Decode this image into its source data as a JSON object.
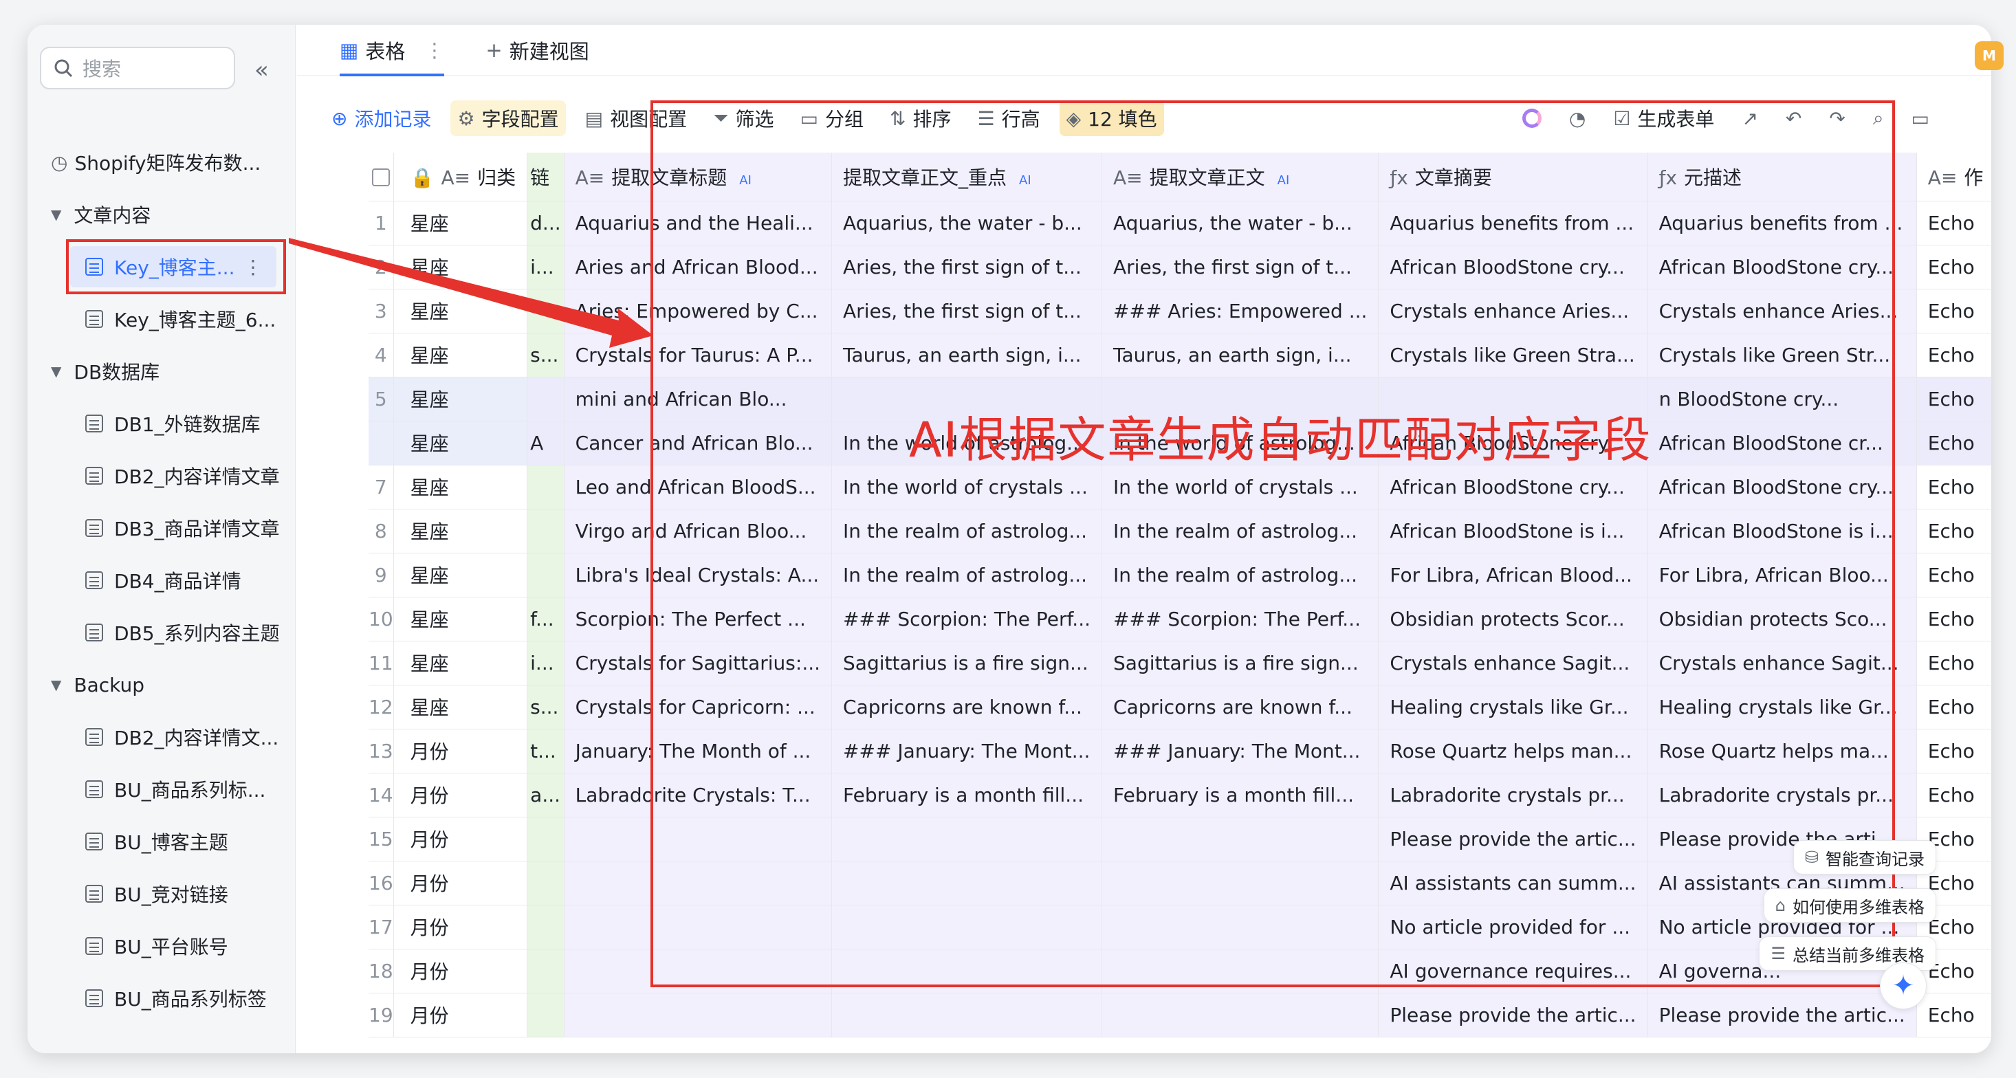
{
  "search": {
    "placeholder": "搜索"
  },
  "sidebar": {
    "collapse_label": "«",
    "items": [
      {
        "label": "Shopify矩阵发布数..."
      },
      {
        "label": "文章内容"
      },
      {
        "label": "Key_博客主..."
      },
      {
        "label": "Key_博客主题_6..."
      },
      {
        "label": "DB数据库"
      },
      {
        "label": "DB1_外链数据库"
      },
      {
        "label": "DB2_内容详情文章"
      },
      {
        "label": "DB3_商品详情文章"
      },
      {
        "label": "DB4_商品详情"
      },
      {
        "label": "DB5_系列内容主题"
      },
      {
        "label": "Backup"
      },
      {
        "label": "DB2_内容详情文..."
      },
      {
        "label": "BU_商品系列标..."
      },
      {
        "label": "BU_博客主题"
      },
      {
        "label": "BU_竞对链接"
      },
      {
        "label": "BU_平台账号"
      },
      {
        "label": "BU_商品系列标签"
      }
    ]
  },
  "tabs": {
    "table": "表格",
    "new_view": "新建视图"
  },
  "toolbar": {
    "add_record": "添加记录",
    "field_config": "字段配置",
    "view_config": "视图配置",
    "filter": "筛选",
    "group": "分组",
    "sort": "排序",
    "row_height": "行高",
    "fill": "12 填色",
    "generate_form": "生成表单"
  },
  "columns": {
    "category": "归类",
    "link_partial": "链",
    "title": "提取文章标题",
    "key_points": "提取文章正文_重点",
    "body": "提取文章正文",
    "summary": "文章摘要",
    "meta": "元描述",
    "author_partial": "作",
    "ai_tag": "AI"
  },
  "rows": [
    {
      "n": "1",
      "cat": "星座",
      "link": "d...",
      "title": "Aquarius and the Heali...",
      "key": "Aquarius, the water - b...",
      "body": "Aquarius, the water - b...",
      "summary": "Aquarius benefits from ...",
      "meta": "Aquarius benefits from ...",
      "au": "Echo"
    },
    {
      "n": "2",
      "cat": "星座",
      "link": "i...",
      "title": "Aries and African Blood...",
      "key": "Aries, the first sign of t...",
      "body": "Aries, the first sign of t...",
      "summary": "African BloodStone cry...",
      "meta": "African BloodStone cry...",
      "au": "Echo"
    },
    {
      "n": "3",
      "cat": "星座",
      "link": "",
      "title": "Aries: Empowered by C...",
      "key": "Aries, the first sign of t...",
      "body": "### Aries: Empowered ...",
      "summary": "Crystals enhance Aries...",
      "meta": "Crystals enhance Aries...",
      "au": "Echo"
    },
    {
      "n": "4",
      "cat": "星座",
      "link": "s...",
      "title": "Crystals for Taurus: A P...",
      "key": "Taurus, an earth sign, i...",
      "body": "Taurus, an earth sign, i...",
      "summary": "Crystals like Green Stra...",
      "meta": "Crystals like Green Str...",
      "au": "Echo"
    },
    {
      "n": "5",
      "cat": "星座",
      "link": "",
      "title": "mini and African Blo...",
      "key": "",
      "body": "",
      "summary": "",
      "meta": "n BloodStone cry...",
      "au": "Echo"
    },
    {
      "n": "",
      "cat": "星座",
      "link": "A",
      "title": "Cancer and African Blo...",
      "key": "In the world of astrolog...",
      "body": "In the world of astrolog...",
      "summary": "African BloodStone cry...",
      "meta": "African BloodStone cr...",
      "au": "Echo"
    },
    {
      "n": "7",
      "cat": "星座",
      "link": "",
      "title": "Leo and African BloodS...",
      "key": "In the world of crystals ...",
      "body": "In the world of crystals ...",
      "summary": "African BloodStone cry...",
      "meta": "African BloodStone cry...",
      "au": "Echo"
    },
    {
      "n": "8",
      "cat": "星座",
      "link": "",
      "title": "Virgo and African Bloo...",
      "key": "In the realm of astrolog...",
      "body": "In the realm of astrolog...",
      "summary": "African BloodStone is i...",
      "meta": "African BloodStone is i...",
      "au": "Echo"
    },
    {
      "n": "9",
      "cat": "星座",
      "link": "",
      "title": "Libra's Ideal Crystals: A...",
      "key": "In the realm of astrolog...",
      "body": "In the realm of astrolog...",
      "summary": "For Libra, African Blood...",
      "meta": "For Libra, African Bloo...",
      "au": "Echo"
    },
    {
      "n": "10",
      "cat": "星座",
      "link": "f...",
      "title": "Scorpion: The Perfect ...",
      "key": "### Scorpion: The Perf...",
      "body": "### Scorpion: The Perf...",
      "summary": "Obsidian protects Scor...",
      "meta": "Obsidian protects Sco...",
      "au": "Echo"
    },
    {
      "n": "11",
      "cat": "星座",
      "link": "i...",
      "title": "Crystals for Sagittarius:...",
      "key": "Sagittarius is a fire sign...",
      "body": "Sagittarius is a fire sign...",
      "summary": "Crystals enhance Sagit...",
      "meta": "Crystals enhance Sagit...",
      "au": "Echo"
    },
    {
      "n": "12",
      "cat": "星座",
      "link": "s...",
      "title": "Crystals for Capricorn: ...",
      "key": "Capricorns are known f...",
      "body": "Capricorns are known f...",
      "summary": "Healing crystals like Gr...",
      "meta": "Healing crystals like Gr...",
      "au": "Echo"
    },
    {
      "n": "13",
      "cat": "月份",
      "link": "t...",
      "title": "January: The Month of ...",
      "key": "### January: The Mont...",
      "body": "### January: The Mont...",
      "summary": "Rose Quartz helps man...",
      "meta": "Rose Quartz helps ma...",
      "au": "Echo"
    },
    {
      "n": "14",
      "cat": "月份",
      "link": "a...",
      "title": "Labradorite Crystals: T...",
      "key": "February is a month fill...",
      "body": "February is a month fill...",
      "summary": "Labradorite crystals pr...",
      "meta": "Labradorite crystals pr...",
      "au": "Echo"
    },
    {
      "n": "15",
      "cat": "月份",
      "link": "",
      "title": "",
      "key": "",
      "body": "",
      "summary": "Please provide the artic...",
      "meta": "Please provide the arti...",
      "au": "Echo"
    },
    {
      "n": "16",
      "cat": "月份",
      "link": "",
      "title": "",
      "key": "",
      "body": "",
      "summary": "AI assistants can summ...",
      "meta": "AI assistants can summ...",
      "au": "Echo"
    },
    {
      "n": "17",
      "cat": "月份",
      "link": "",
      "title": "",
      "key": "",
      "body": "",
      "summary": "No article provided for ...",
      "meta": "No article provided for ...",
      "au": "Echo"
    },
    {
      "n": "18",
      "cat": "月份",
      "link": "",
      "title": "",
      "key": "",
      "body": "",
      "summary": "AI governance requires...",
      "meta": "AI governa...",
      "au": "Echo"
    },
    {
      "n": "19",
      "cat": "月份",
      "link": "",
      "title": "",
      "key": "",
      "body": "",
      "summary": "Please provide the artic...",
      "meta": "Please provide the artic...",
      "au": "Echo"
    }
  ],
  "annotation": {
    "text": "AI根据文章生成自动匹配对应字段"
  },
  "ai_panel": {
    "query": "智能查询记录",
    "howto": "如何使用多维表格",
    "summarize": "总结当前多维表格"
  },
  "corner_badge": "M",
  "colors": {
    "accent": "#3370ff",
    "annotation_red": "#e5322d",
    "ai_column_bg": "#f2f0fd",
    "link_column_bg": "#e9f6e3"
  }
}
